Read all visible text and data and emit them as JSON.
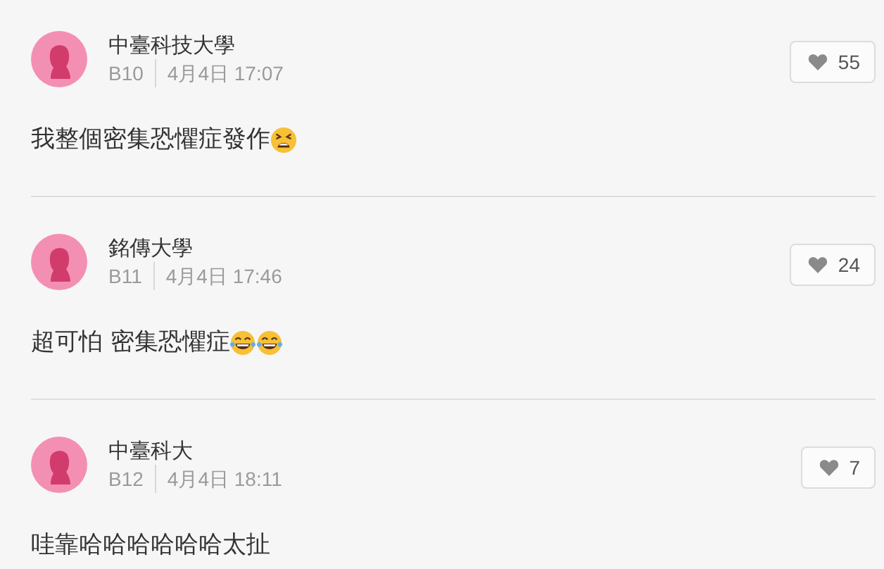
{
  "comments": [
    {
      "school": "中臺科技大學",
      "floor": "B10",
      "time": "4月4日 17:07",
      "likes": "55",
      "text": "我整個密集恐懼症發作",
      "emojis": [
        {
          "kind": "tired"
        }
      ]
    },
    {
      "school": "銘傳大學",
      "floor": "B11",
      "time": "4月4日 17:46",
      "likes": "24",
      "text": "超可怕 密集恐懼症",
      "emojis": [
        {
          "kind": "joy"
        },
        {
          "kind": "joy"
        }
      ]
    },
    {
      "school": "中臺科大",
      "floor": "B12",
      "time": "4月4日 18:11",
      "likes": "7",
      "text": "哇靠哈哈哈哈哈哈太扯"
    }
  ]
}
